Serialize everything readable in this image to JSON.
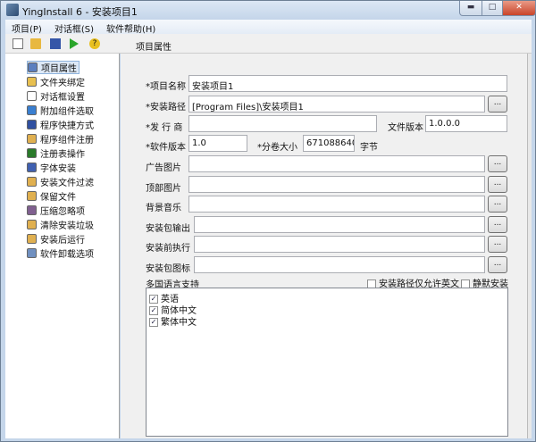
{
  "window": {
    "title": "YingInstall 6 - 安装项目1",
    "minimize": "▬",
    "maximize": "□",
    "close": "✕"
  },
  "menu": [
    "项目(P)",
    "对话框(S)",
    "软件帮助(H)"
  ],
  "toolbar": {
    "icons": [
      "new-icon",
      "open-icon",
      "save-icon",
      "run-icon",
      "help-icon"
    ],
    "title": "项目属性"
  },
  "tree": [
    "项目属性",
    "文件夹绑定",
    "对话框设置",
    "附加组件选取",
    "程序快捷方式",
    "程序组件注册",
    "注册表操作",
    "字体安装",
    "安装文件过滤",
    "保留文件",
    "压缩忽略项",
    "清除安装垃圾",
    "安装后运行",
    "软件卸载选项"
  ],
  "form": {
    "name_label": "*项目名称",
    "name_value": "安装项目1",
    "path_label": "*安装路径",
    "path_value": "[Program Files]\\安装项目1",
    "publisher_label": "*发 行 商",
    "publisher_value": "",
    "file_version_label": "文件版本",
    "file_version_value": "1.0.0.0",
    "soft_version_label": "*软件版本",
    "soft_version_value": "1.0",
    "volume_label": "*分卷大小",
    "volume_value": "671088640",
    "volume_unit": "字节",
    "ad_label": "广告图片",
    "top_label": "顶部图片",
    "music_label": "背景音乐",
    "output_label": "安装包输出",
    "pre_label": "安装前执行",
    "icon_label": "安装包图标",
    "browse": "...",
    "lang_label": "多国语言支持",
    "english_path_label": "安装路径仅允许英文",
    "english_path_checked": false,
    "silent_label": "静默安装",
    "silent_checked": false,
    "languages": [
      {
        "label": "英语",
        "checked": true
      },
      {
        "label": "简体中文",
        "checked": true
      },
      {
        "label": "繁体中文",
        "checked": true
      }
    ],
    "check_mark": "✓"
  }
}
